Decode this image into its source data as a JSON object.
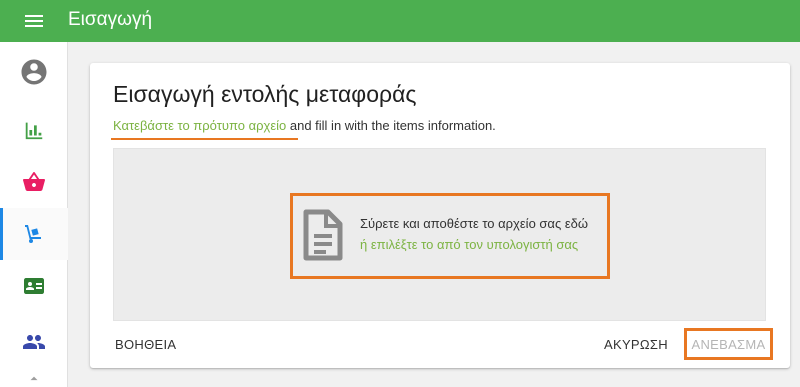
{
  "app": {
    "title": "Εισαγωγή"
  },
  "sidebar": {
    "items": [
      {
        "icon": "account-circle-icon",
        "color": "#757575"
      },
      {
        "icon": "bar-chart-icon",
        "color": "#43a047"
      },
      {
        "icon": "basket-icon",
        "color": "#e91e63"
      },
      {
        "icon": "hand-truck-icon",
        "color": "#1e88e5",
        "active": true
      },
      {
        "icon": "id-card-icon",
        "color": "#2e7d32"
      },
      {
        "icon": "people-icon",
        "color": "#3949ab"
      }
    ]
  },
  "card": {
    "title": "Εισαγωγή εντολής μεταφοράς",
    "template_link": "Κατεβάστε το πρότυπο αρχείο",
    "template_suffix": " and fill in with the items information."
  },
  "dropzone": {
    "line1": "Σύρετε και αποθέστε το αρχείο σας εδώ",
    "line2": "ή επιλέξτε το από τον υπολογιστή σας",
    "icon": "file-document-icon"
  },
  "actions": {
    "help": "ΒΟΗΘΕΙΑ",
    "cancel": "ΑΚΥΡΩΣΗ",
    "upload": "ΑΝΕΒΑΣΜΑ"
  },
  "colors": {
    "appbar": "#4caf50",
    "link": "#7cb342",
    "annotation": "#e87722"
  }
}
